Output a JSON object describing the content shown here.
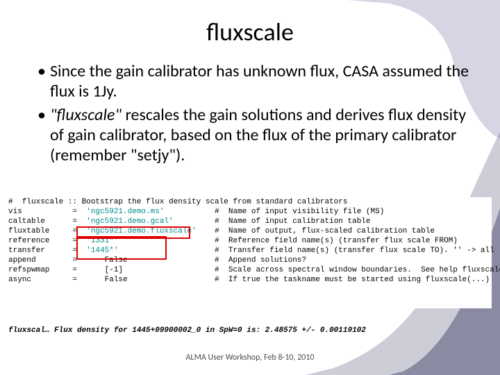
{
  "title": "fluxscale",
  "bullets": [
    {
      "pre": "Since the gain calibrator has unknown flux, CASA assumed the flux is 1Jy.",
      "em": "",
      "post": ""
    },
    {
      "pre": "",
      "em": "\"fluxscale\"",
      "post": " rescales the gain solutions and derives flux density of gain calibrator, based on the flux of the primary calibrator (remember \"setjy\")."
    }
  ],
  "code": {
    "header": "#  fluxscale :: Bootstrap the flux density scale from standard calibrators",
    "rows": [
      {
        "param": "vis",
        "val": "'ngc5921.demo.ms'",
        "comment": "#  Name of input visibility file (MS)"
      },
      {
        "param": "caltable",
        "val": "'ngc5921.demo.gcal'",
        "comment": "#  Name of input calibration table"
      },
      {
        "param": "fluxtable",
        "val": "'ngc5921.demo.fluxscale'",
        "comment": "#  Name of output, flux-scaled calibration table"
      },
      {
        "param": "reference",
        "val": "'1331*'",
        "comment": "#  Reference field name(s) (transfer flux scale FROM)"
      },
      {
        "param": "transfer",
        "val": "'1445*'",
        "comment": "#  Transfer field name(s) (transfer flux scale TO). '' -> all"
      },
      {
        "param": "append",
        "val": "False",
        "comment": "#  Append solutions?"
      },
      {
        "param": "refspwmap",
        "val": "[-1]",
        "comment": "#  Scale across spectral window boundaries.  See help fluxscale"
      },
      {
        "param": "async",
        "val": "False",
        "comment": "#  If true the taskname must be started using fluxscale(...)"
      }
    ]
  },
  "output": "fluxscal…   Flux density for 1445+09900002_0 in SpW=0 is: 2.48575 +/- 0.00119102",
  "footer": "ALMA User Workshop, Feb 8-10, 2010"
}
